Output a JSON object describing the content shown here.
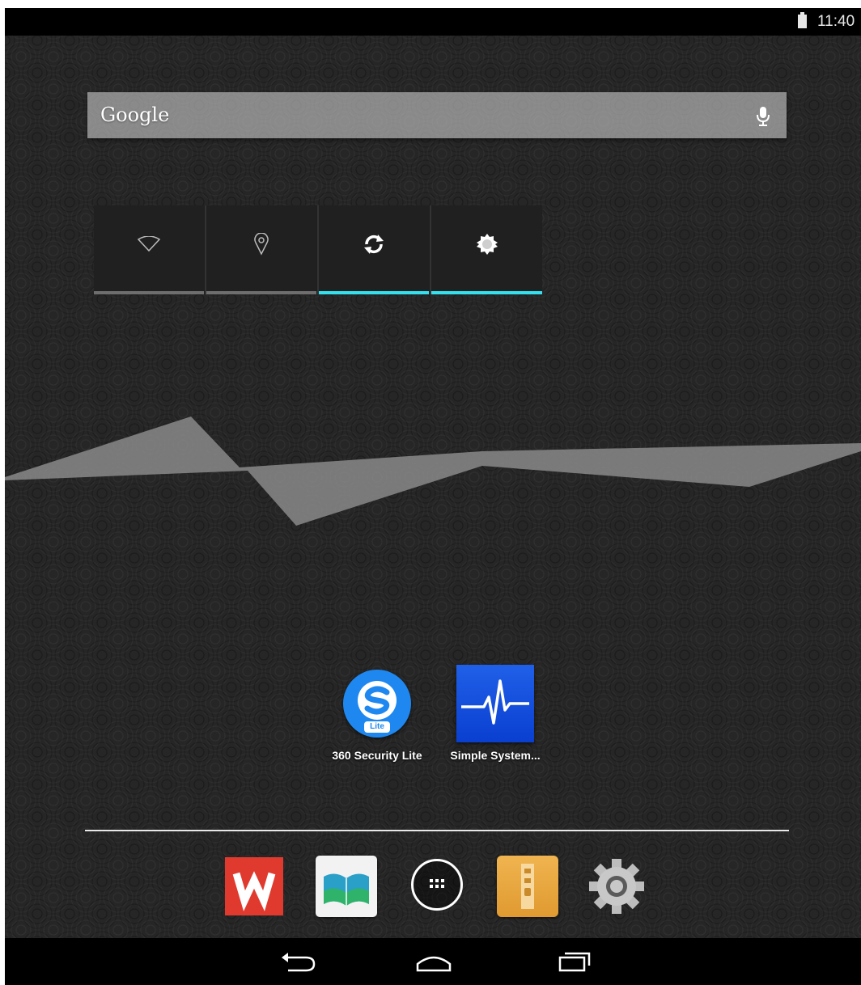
{
  "status_bar": {
    "time": "11:40",
    "battery_icon": "battery-icon"
  },
  "search": {
    "label": "Google",
    "mic_icon": "mic-icon"
  },
  "power_widget": {
    "toggles": [
      {
        "name": "wifi",
        "icon": "wifi-icon",
        "active": false
      },
      {
        "name": "location",
        "icon": "location-icon",
        "active": false
      },
      {
        "name": "sync",
        "icon": "sync-icon",
        "active": true
      },
      {
        "name": "brightness",
        "icon": "brightness-icon",
        "active": true
      }
    ],
    "active_color": "#33e0f0",
    "inactive_color": "#6e6e6e"
  },
  "apps": [
    {
      "label": "360 Security Lite",
      "badge": "Lite",
      "icon": "360-security-icon"
    },
    {
      "label": "Simple System...",
      "icon": "system-monitor-icon"
    }
  ],
  "dock": [
    {
      "name": "wps-office",
      "icon": "wps-icon",
      "letter": "W"
    },
    {
      "name": "gallery",
      "icon": "gallery-icon"
    },
    {
      "name": "app-drawer",
      "icon": "app-drawer-icon"
    },
    {
      "name": "archive",
      "icon": "archive-icon"
    },
    {
      "name": "settings",
      "icon": "settings-gear-icon"
    }
  ],
  "nav_bar": {
    "buttons": [
      "back-icon",
      "home-icon",
      "recents-icon"
    ]
  }
}
